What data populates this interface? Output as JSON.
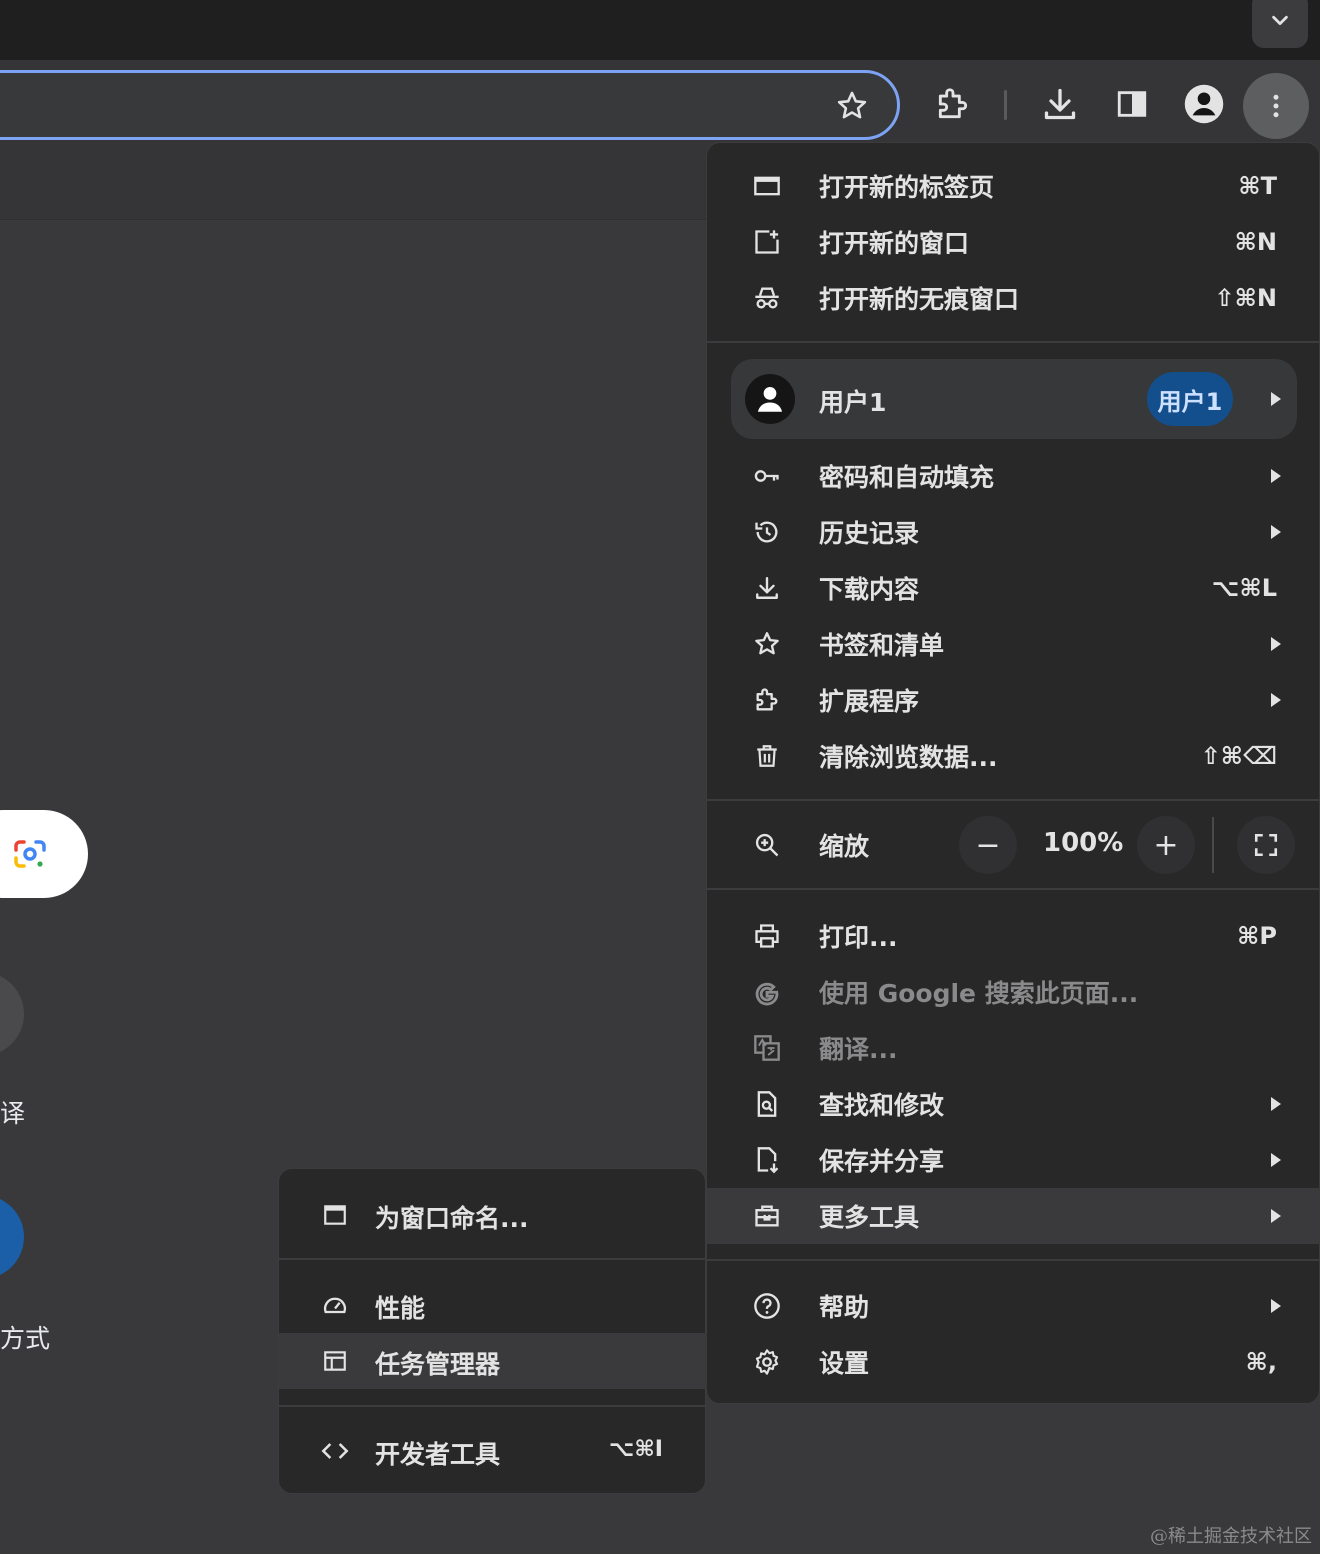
{
  "tabstrip": {
    "dropdown_icon": "chevron-down-icon"
  },
  "toolbar": {
    "bookmark_icon": "star-icon",
    "extensions_icon": "puzzle-icon",
    "downloads_icon": "download-icon",
    "side_panel_icon": "side-panel-icon",
    "profile_icon": "person-icon",
    "menu_icon": "more-vert-icon"
  },
  "page": {
    "fragments": [
      "译",
      "方式"
    ],
    "lens_icon": "google-lens-icon"
  },
  "menu": {
    "group1": [
      {
        "label": "打开新的标签页",
        "shortcut": "⌘T",
        "icon": "new-tab-icon"
      },
      {
        "label": "打开新的窗口",
        "shortcut": "⌘N",
        "icon": "new-window-icon"
      },
      {
        "label": "打开新的无痕窗口",
        "shortcut": "⇧⌘N",
        "icon": "incognito-icon"
      }
    ],
    "profile": {
      "label": "用户1",
      "chip": "用户1"
    },
    "group2": [
      {
        "label": "密码和自动填充",
        "icon": "key-icon"
      },
      {
        "label": "历史记录",
        "icon": "history-icon"
      },
      {
        "label": "下载内容",
        "shortcut": "⌥⌘L",
        "icon": "download-icon"
      },
      {
        "label": "书签和清单",
        "icon": "star-icon"
      },
      {
        "label": "扩展程序",
        "icon": "puzzle-icon"
      },
      {
        "label": "清除浏览数据...",
        "shortcut": "⇧⌘⌫",
        "icon": "trash-icon"
      }
    ],
    "zoom": {
      "label": "缩放",
      "minus": "−",
      "value": "100%",
      "plus": "+"
    },
    "group3": [
      {
        "label": "打印...",
        "shortcut": "⌘P",
        "icon": "print-icon"
      },
      {
        "label": "使用 Google 搜索此页面...",
        "icon": "google-icon",
        "disabled": true
      },
      {
        "label": "翻译...",
        "icon": "translate-icon",
        "disabled": true
      },
      {
        "label": "查找和修改",
        "icon": "find-icon"
      },
      {
        "label": "保存并分享",
        "icon": "save-share-icon"
      },
      {
        "label": "更多工具",
        "icon": "toolbox-icon",
        "highlighted": true
      }
    ],
    "group4": [
      {
        "label": "帮助",
        "icon": "help-icon"
      },
      {
        "label": "设置",
        "shortcut": "⌘,",
        "icon": "gear-icon"
      }
    ]
  },
  "submenu": [
    {
      "label": "为窗口命名...",
      "icon": "window-icon"
    },
    {
      "label": "性能",
      "icon": "speedometer-icon"
    },
    {
      "label": "任务管理器",
      "icon": "task-manager-icon",
      "highlighted": true
    },
    {
      "label": "开发者工具",
      "shortcut": "⌥⌘I",
      "icon": "code-icon"
    }
  ],
  "watermark": "@稀土掘金技术社区"
}
